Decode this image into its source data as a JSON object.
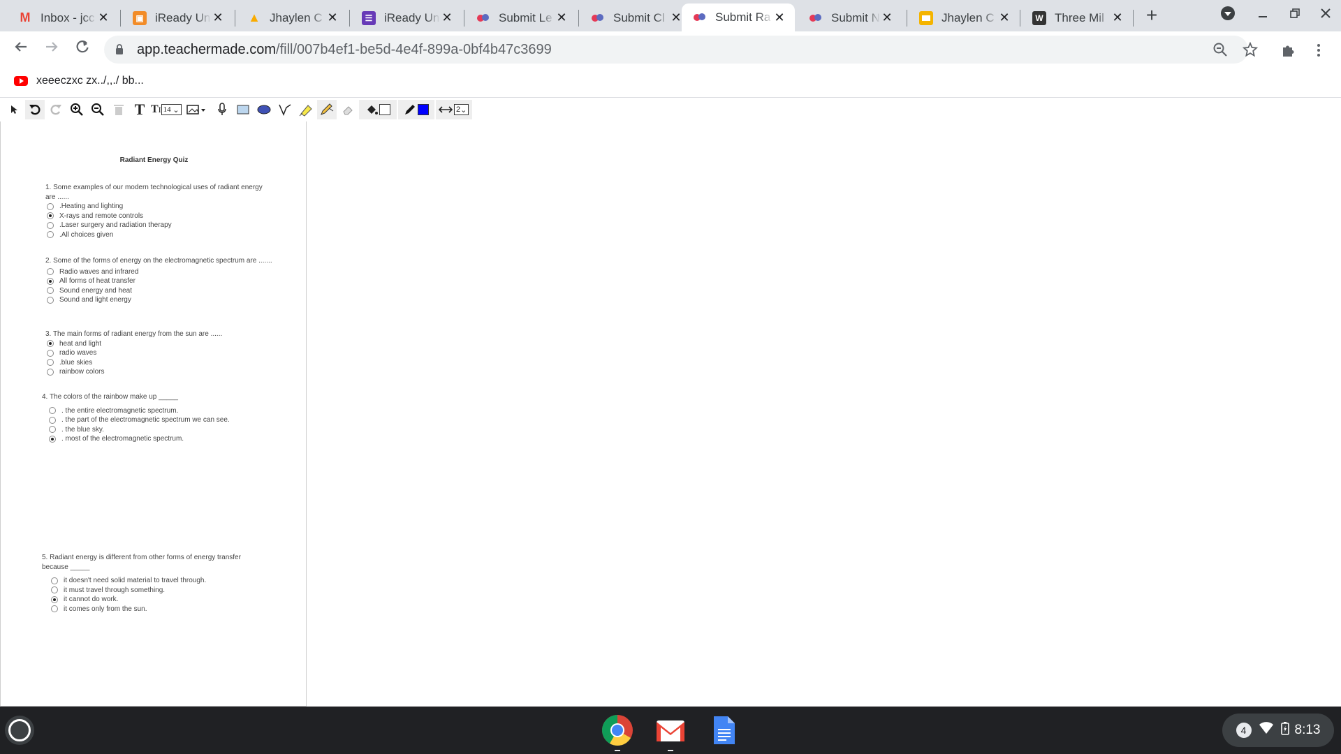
{
  "browser": {
    "tabs": [
      {
        "title": "Inbox - jcc",
        "icon": "gmail-icon",
        "active": false
      },
      {
        "title": "iReady Un",
        "icon": "iready-icon",
        "active": false
      },
      {
        "title": "Jhaylen C",
        "icon": "drive-icon",
        "active": false
      },
      {
        "title": "iReady Un",
        "icon": "forms-icon",
        "active": false
      },
      {
        "title": "Submit Le",
        "icon": "teachermade-icon",
        "active": false
      },
      {
        "title": "Submit Cl",
        "icon": "teachermade-icon",
        "active": false
      },
      {
        "title": "Submit Ra",
        "icon": "teachermade-icon",
        "active": true
      },
      {
        "title": "Submit Ne",
        "icon": "teachermade-icon",
        "active": false
      },
      {
        "title": "Jhaylen C",
        "icon": "slides-icon",
        "active": false
      },
      {
        "title": "Three Mil",
        "icon": "word-icon",
        "active": false
      }
    ],
    "new_tab_symbol": "+",
    "url_host": "app.teachermade.com",
    "url_path": "/fill/007b4ef1-be5d-4e4f-899a-0bf4b47c3699",
    "bookmark": "xeeeczxc zx../,,./ bb..."
  },
  "toolbar": {
    "font_size": "14",
    "line_width": "2",
    "pen_color": "#0000ff"
  },
  "quiz": {
    "title": "Radiant Energy Quiz",
    "questions": [
      {
        "stem": "1. Some examples of our modern technological uses of radiant energy are ......",
        "options": [
          ".Heating and lighting",
          "X-rays and remote controls",
          ".Laser surgery and radiation therapy",
          ".All choices given"
        ],
        "selected": 1
      },
      {
        "stem": "2. Some of the forms of energy on the electromagnetic spectrum are .......",
        "options": [
          "Radio waves and infrared",
          "All forms of heat transfer",
          "Sound energy and heat",
          "Sound and light energy"
        ],
        "selected": 1
      },
      {
        "stem": "3. The main forms of radiant energy from the sun are ......",
        "options": [
          "heat and light",
          "radio waves",
          ".blue skies",
          "rainbow colors"
        ],
        "selected": 0
      },
      {
        "stem": "4. The colors of the rainbow make up _____",
        "options": [
          ". the entire electromagnetic spectrum.",
          ". the part of the electromagnetic spectrum we can see.",
          ". the blue sky.",
          ". most of the electromagnetic spectrum."
        ],
        "selected": 3
      },
      {
        "stem": "5. Radiant energy is different from other forms of energy transfer because _____",
        "options": [
          "it doesn't need solid material to travel through.",
          "it must travel through something.",
          "it cannot do work.",
          "it comes only from the sun."
        ],
        "selected": 2
      }
    ]
  },
  "shelf": {
    "apps": [
      "chrome-icon",
      "gmail-icon",
      "docs-icon"
    ],
    "notification_count": "4",
    "time": "8:13"
  }
}
